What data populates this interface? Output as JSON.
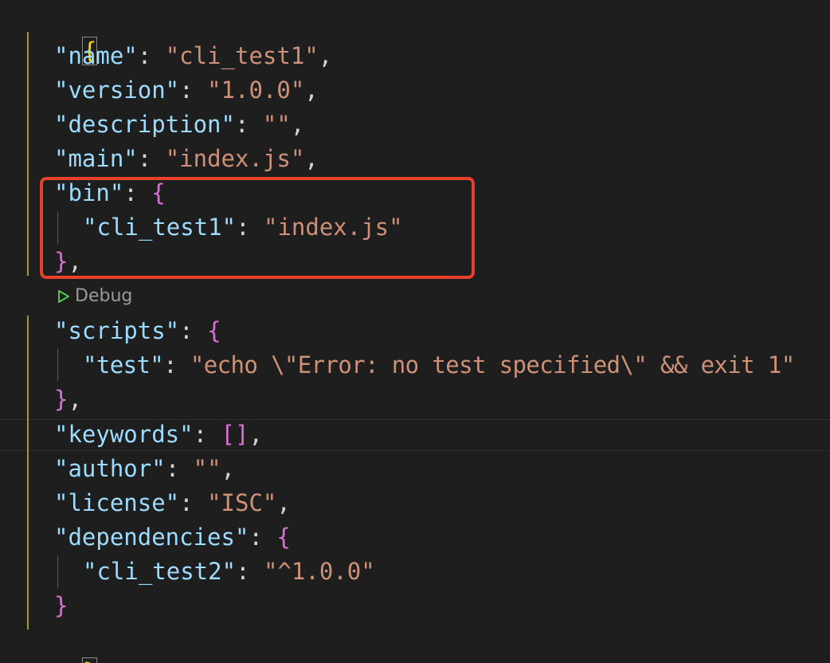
{
  "editor": {
    "colors": {
      "background": "#1e1e1e",
      "key": "#9cdcfe",
      "string": "#ce9178",
      "punctuation": "#d4d4d4",
      "brace_level1": "#ffd700",
      "brace_level2": "#da70d6",
      "highlight_box": "#e8402b"
    },
    "codelens": {
      "icon": "play-icon",
      "label": "Debug"
    },
    "lines": {
      "open_brace": "{",
      "name_key": "\"name\"",
      "name_value": "\"cli_test1\"",
      "version_key": "\"version\"",
      "version_value": "\"1.0.0\"",
      "description_key": "\"description\"",
      "description_value": "\"\"",
      "main_key": "\"main\"",
      "main_value": "\"index.js\"",
      "bin_key": "\"bin\"",
      "bin_open": "{",
      "bin_entry_key": "\"cli_test1\"",
      "bin_entry_value": "\"index.js\"",
      "bin_close": "}",
      "scripts_key": "\"scripts\"",
      "scripts_open": "{",
      "test_key": "\"test\"",
      "test_value": "\"echo \\\"Error: no test specified\\\" && exit 1\"",
      "scripts_close": "}",
      "keywords_key": "\"keywords\"",
      "keywords_value": "[]",
      "author_key": "\"author\"",
      "author_value": "\"\"",
      "license_key": "\"license\"",
      "license_value": "\"ISC\"",
      "dependencies_key": "\"dependencies\"",
      "dependencies_open": "{",
      "dep_entry_key": "\"cli_test2\"",
      "dep_entry_value": "\"^1.0.0\"",
      "dependencies_close": "}",
      "close_brace": "}"
    }
  }
}
